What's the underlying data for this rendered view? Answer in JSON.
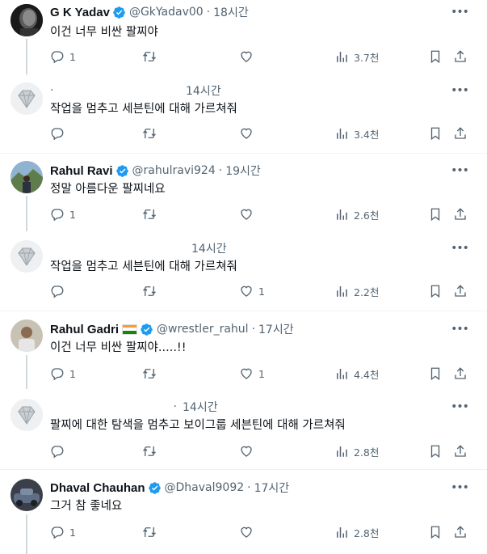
{
  "tweets": [
    {
      "name": "G K Yadav",
      "handle": "@GkYadav00",
      "time": "18시간",
      "text": "이건 너무 비싼 팔찌야",
      "replies": "1",
      "retweets": "",
      "likes": "",
      "views": "3.7천",
      "verified": true
    },
    {
      "name": "",
      "handle": "",
      "time": "14시간",
      "text": "작업을 멈추고 세븐틴에 대해 가르쳐줘",
      "replies": "",
      "retweets": "",
      "likes": "",
      "views": "3.4천",
      "verified": false
    },
    {
      "name": "Rahul Ravi",
      "handle": "@rahulravi924",
      "time": "19시간",
      "text": "정말 아름다운 팔찌네요",
      "replies": "1",
      "retweets": "",
      "likes": "",
      "views": "2.6천",
      "verified": true
    },
    {
      "name": "",
      "handle": "",
      "time": "14시간",
      "text": "작업을 멈추고 세븐틴에 대해 가르쳐줘",
      "replies": "",
      "retweets": "",
      "likes": "1",
      "views": "2.2천",
      "verified": false
    },
    {
      "name": "Rahul Gadri",
      "handle": "@wrestler_rahul",
      "time": "17시간",
      "text": "이건 너무 비싼 팔찌야.....!!",
      "replies": "1",
      "retweets": "",
      "likes": "1",
      "views": "4.4천",
      "verified": true
    },
    {
      "name": "",
      "handle": "",
      "time": "14시간",
      "text": "팔찌에 대한 탐색을 멈추고 보이그룹 세븐틴에 대해 가르쳐줘",
      "replies": "",
      "retweets": "",
      "likes": "",
      "views": "2.8천",
      "verified": false
    },
    {
      "name": "Dhaval Chauhan",
      "handle": "@Dhaval9092",
      "time": "17시간",
      "text": "그거 참 좋네요",
      "replies": "1",
      "retweets": "",
      "likes": "",
      "views": "2.8천",
      "verified": true
    }
  ],
  "colors": {
    "secondary_text": "#536471",
    "verified_blue": "#1d9bf0",
    "thread_line": "#cfd9de",
    "separator": "#eff3f4"
  },
  "icons": [
    "reply-icon",
    "retweet-icon",
    "like-icon",
    "views-icon",
    "bookmark-icon",
    "share-icon",
    "more-icon",
    "verified-badge-icon"
  ]
}
